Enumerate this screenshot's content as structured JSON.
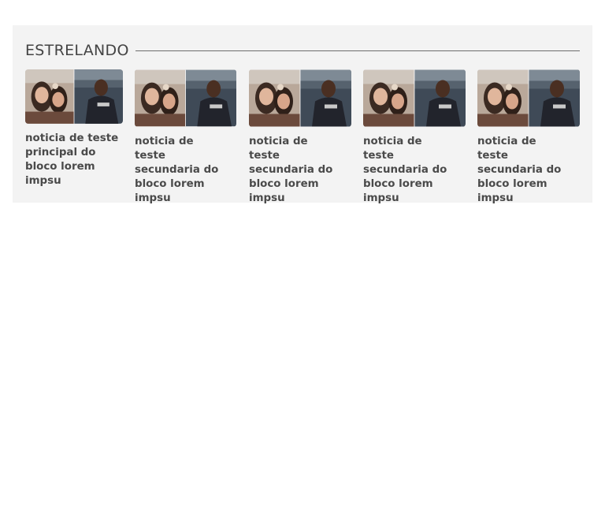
{
  "section": {
    "heading": "ESTRELANDO"
  },
  "main_story": {
    "title": "noticia de teste principal do bloco lorem impsu",
    "thumb_icon": "news-photo-thumbnail"
  },
  "secondary_stories": [
    {
      "title": "noticia de teste secundaria do bloco lorem impsu"
    },
    {
      "title": "noticia de teste secundaria do bloco lorem impsu"
    },
    {
      "title": "noticia de teste secundaria do bloco lorem impsu"
    },
    {
      "title": "noticia de teste secundaria do bloco lorem impsu"
    }
  ],
  "colors": {
    "block_background": "#f3f3f3",
    "heading_text": "#444444",
    "title_text": "#4a4a4a",
    "rule": "#6e6e6e"
  }
}
